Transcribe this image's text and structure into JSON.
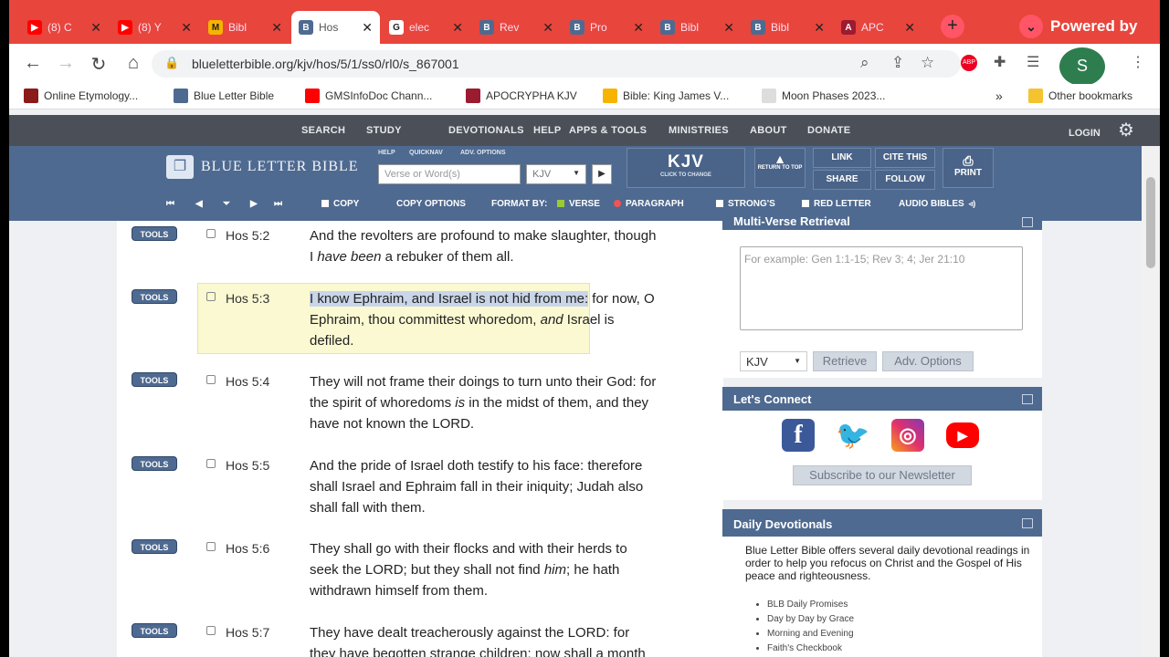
{
  "browser": {
    "tabs": [
      {
        "title": "(8) C",
        "fav": "▶",
        "favbg": "#ff0000"
      },
      {
        "title": "(8) Y",
        "fav": "▶",
        "favbg": "#ff0000"
      },
      {
        "title": "Bibl",
        "fav": "M",
        "favbg": "#f6b400"
      },
      {
        "title": "Hos",
        "fav": "B",
        "favbg": "#4f6a90"
      },
      {
        "title": "elec",
        "fav": "G",
        "favbg": "#ffffff"
      },
      {
        "title": "Rev",
        "fav": "B",
        "favbg": "#4f6a90"
      },
      {
        "title": "Pro",
        "fav": "B",
        "favbg": "#4f6a90"
      },
      {
        "title": "Bibl",
        "fav": "B",
        "favbg": "#4f6a90"
      },
      {
        "title": "Bibl",
        "fav": "B",
        "favbg": "#4f6a90"
      },
      {
        "title": "APC",
        "fav": "A",
        "favbg": "#9b1b30"
      }
    ],
    "active_tab": 3,
    "new_tab": "+",
    "powered_by": "Powered by",
    "url": "blueletterbible.org/kjv/hos/5/1/ss0/rl0/s_867001",
    "bookmarks": [
      {
        "label": "Online Etymology...",
        "bg": "#8b1a1a"
      },
      {
        "label": "Blue Letter Bible",
        "bg": "#4f6a90"
      },
      {
        "label": "GMSInfoDoc Chann...",
        "bg": "#ff0000"
      },
      {
        "label": "APOCRYPHA KJV",
        "bg": "#9b1b30"
      },
      {
        "label": "Bible: King James V...",
        "bg": "#f6b400"
      },
      {
        "label": "Moon Phases 2023...",
        "bg": "#dddddd"
      }
    ],
    "bookmarks_overflow": "»",
    "other_bookmarks": "Other bookmarks"
  },
  "site": {
    "nav": [
      "SEARCH",
      "STUDY",
      "DEVOTIONALS",
      "HELP",
      "APPS & TOOLS",
      "MINISTRIES",
      "ABOUT",
      "DONATE"
    ],
    "login": "LOGIN",
    "logo": "BLUE LETTER BIBLE",
    "sub_links": [
      "HELP",
      "QUICKNAV",
      "ADV. OPTIONS"
    ],
    "search_placeholder": "Verse or Word(s)",
    "version": "KJV",
    "version_big": "KJV",
    "version_sub": "CLICK TO CHANGE",
    "return_top": "RETURN TO TOP",
    "link": "LINK",
    "share": "SHARE",
    "cite": "CITE THIS",
    "follow": "FOLLOW",
    "print": "PRINT",
    "copy": "COPY",
    "copy_options": "COPY OPTIONS",
    "format_by": "FORMAT BY:",
    "verse": "VERSE",
    "paragraph": "PARAGRAPH",
    "strongs": "STRONG'S",
    "red_letter": "RED LETTER",
    "audio_bibles": "AUDIO BIBLES"
  },
  "verses": [
    {
      "ref": "Hos 5:2",
      "tools": "TOOLS",
      "lines": [
        "And the revolters are profound to make slaughter, though",
        "I <em>have been</em> a rebuker of them all."
      ]
    },
    {
      "ref": "Hos 5:3",
      "tools": "TOOLS",
      "lines": [
        "<span class=\"sel\">I know Ephraim, and Israel is not hid from me:</span> for now, O",
        "Ephraim, thou committest whoredom, <em>and</em> Israel is",
        "defiled."
      ]
    },
    {
      "ref": "Hos 5:4",
      "tools": "TOOLS",
      "lines": [
        "They will not frame their doings to turn unto their God: for",
        "the spirit of whoredoms <em>is</em> in the midst of them, and they",
        "have not known the LORD."
      ]
    },
    {
      "ref": "Hos 5:5",
      "tools": "TOOLS",
      "lines": [
        "And the pride of Israel doth testify to his face: therefore",
        "shall Israel and Ephraim fall in their iniquity; Judah also",
        "shall fall with them."
      ]
    },
    {
      "ref": "Hos 5:6",
      "tools": "TOOLS",
      "lines": [
        "They shall go with their flocks and with their herds to",
        "seek the LORD; but they shall not find <em>him</em>; he hath",
        "withdrawn himself from them."
      ]
    },
    {
      "ref": "Hos 5:7",
      "tools": "TOOLS",
      "lines": [
        "They have dealt treacherously against the LORD: for",
        "they have begotten strange children: now shall a month"
      ]
    }
  ],
  "sidebar": {
    "multi_title": "Multi-Verse Retrieval",
    "multi_placeholder": "For example: Gen 1:1-15; Rev 3; 4; Jer 21:10",
    "multi_version": "KJV",
    "retrieve": "Retrieve",
    "adv_options": "Adv. Options",
    "connect_title": "Let's Connect",
    "newsletter": "Subscribe to our Newsletter",
    "devo_title": "Daily Devotionals",
    "devo_text": "Blue Letter Bible offers several daily devotional readings in order to help you refocus on Christ and the Gospel of His peace and righteousness.",
    "devo_items": [
      "BLB Daily Promises",
      "Day by Day by Grace",
      "Morning and Evening",
      "Faith's Checkbook"
    ]
  }
}
